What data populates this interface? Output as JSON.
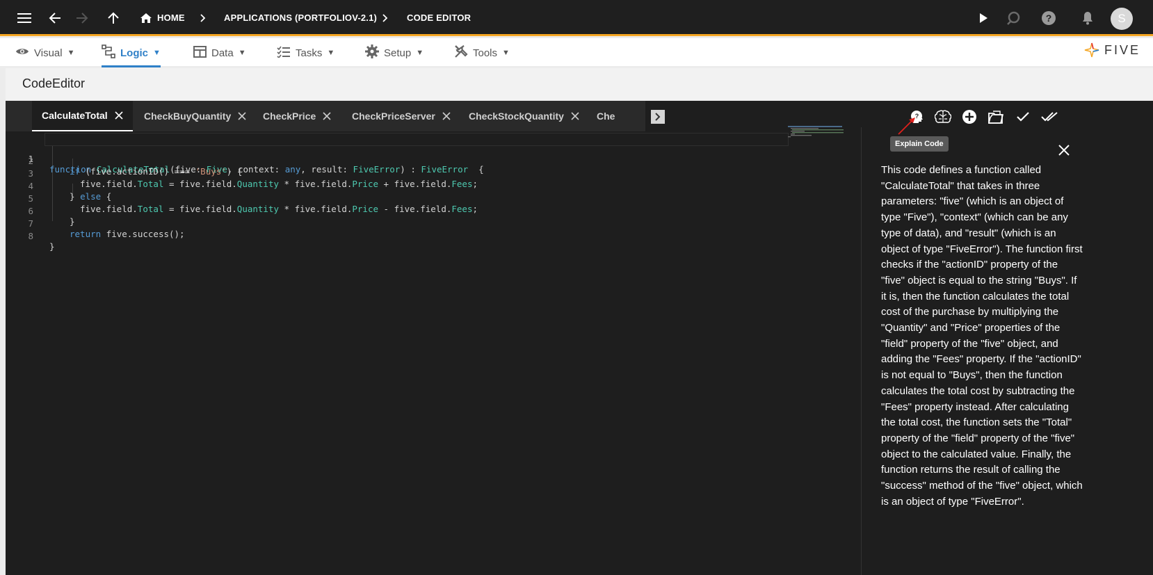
{
  "topbar": {
    "breadcrumbs": [
      "HOME",
      "APPLICATIONS (PORTFOLIOV-2.1)",
      "CODE EDITOR"
    ],
    "avatar_initial": "S"
  },
  "menu": {
    "items": [
      {
        "label": "Visual",
        "icon": "eye-icon"
      },
      {
        "label": "Logic",
        "icon": "logic-icon",
        "active": true
      },
      {
        "label": "Data",
        "icon": "table-icon"
      },
      {
        "label": "Tasks",
        "icon": "tasks-icon"
      },
      {
        "label": "Setup",
        "icon": "gear-icon"
      },
      {
        "label": "Tools",
        "icon": "tools-icon"
      }
    ],
    "caret": "▼",
    "logo_text": "FIVE"
  },
  "page": {
    "title": "CodeEditor"
  },
  "tabs": [
    {
      "label": "CalculateTotal",
      "active": true
    },
    {
      "label": "CheckBuyQuantity"
    },
    {
      "label": "CheckPrice"
    },
    {
      "label": "CheckPriceServer"
    },
    {
      "label": "CheckStockQuantity"
    },
    {
      "label": "Che"
    }
  ],
  "code": {
    "line_numbers": [
      "1",
      "2",
      "3",
      "4",
      "5",
      "6",
      "7",
      "8"
    ],
    "l1": {
      "a": "function",
      "b": "CalculateTotal",
      "c": "(five: ",
      "d": "Five",
      "e": ", context: ",
      "f": "any",
      "g": ", result: ",
      "h": "FiveError",
      "i": ") : ",
      "j": "FiveError",
      "k": "  {"
    },
    "l2": {
      "a": "if",
      "b": " (five.actionID() === ",
      "c": "'Buys'",
      "d": ") {"
    },
    "l3": {
      "a": "five.field.",
      "b": "Total",
      "c": " = five.field.",
      "d": "Quantity",
      "e": " * five.field.",
      "f": "Price",
      "g": " + five.field.",
      "h": "Fees",
      "i": ";"
    },
    "l4": {
      "a": "} ",
      "b": "else",
      "c": " {"
    },
    "l5": {
      "a": "five.field.",
      "b": "Total",
      "c": " = five.field.",
      "d": "Quantity",
      "e": " * five.field.",
      "f": "Price",
      "g": " - five.field.",
      "h": "Fees",
      "i": ";"
    },
    "l6": {
      "a": "}"
    },
    "l7": {
      "a": "return",
      "b": " five.success();"
    },
    "l8": {
      "a": "}"
    }
  },
  "explain": {
    "tooltip": "Explain Code",
    "text": "This code defines a function called \"CalculateTotal\" that takes in three parameters: \"five\" (which is an object of type \"Five\"), \"context\" (which can be any type of data), and \"result\" (which is an object of type \"FiveError\"). The function first checks if the \"actionID\" property of the \"five\" object is equal to the string \"Buys\". If it is, then the function calculates the total cost of the purchase by multiplying the \"Quantity\" and \"Price\" properties of the \"field\" property of the \"five\" object, and adding the \"Fees\" property. If the \"actionID\" is not equal to \"Buys\", then the function calculates the total cost by subtracting the \"Fees\" property instead. After calculating the total cost, the function sets the \"Total\" property of the \"field\" property of the \"five\" object to the calculated value. Finally, the function returns the result of calling the \"success\" method of the \"five\" object, which is an object of type \"FiveError\"."
  },
  "colors": {
    "accent": "#2f80c8",
    "topbar_border": "#f5a623",
    "editor_bg": "#1e1e1e"
  }
}
